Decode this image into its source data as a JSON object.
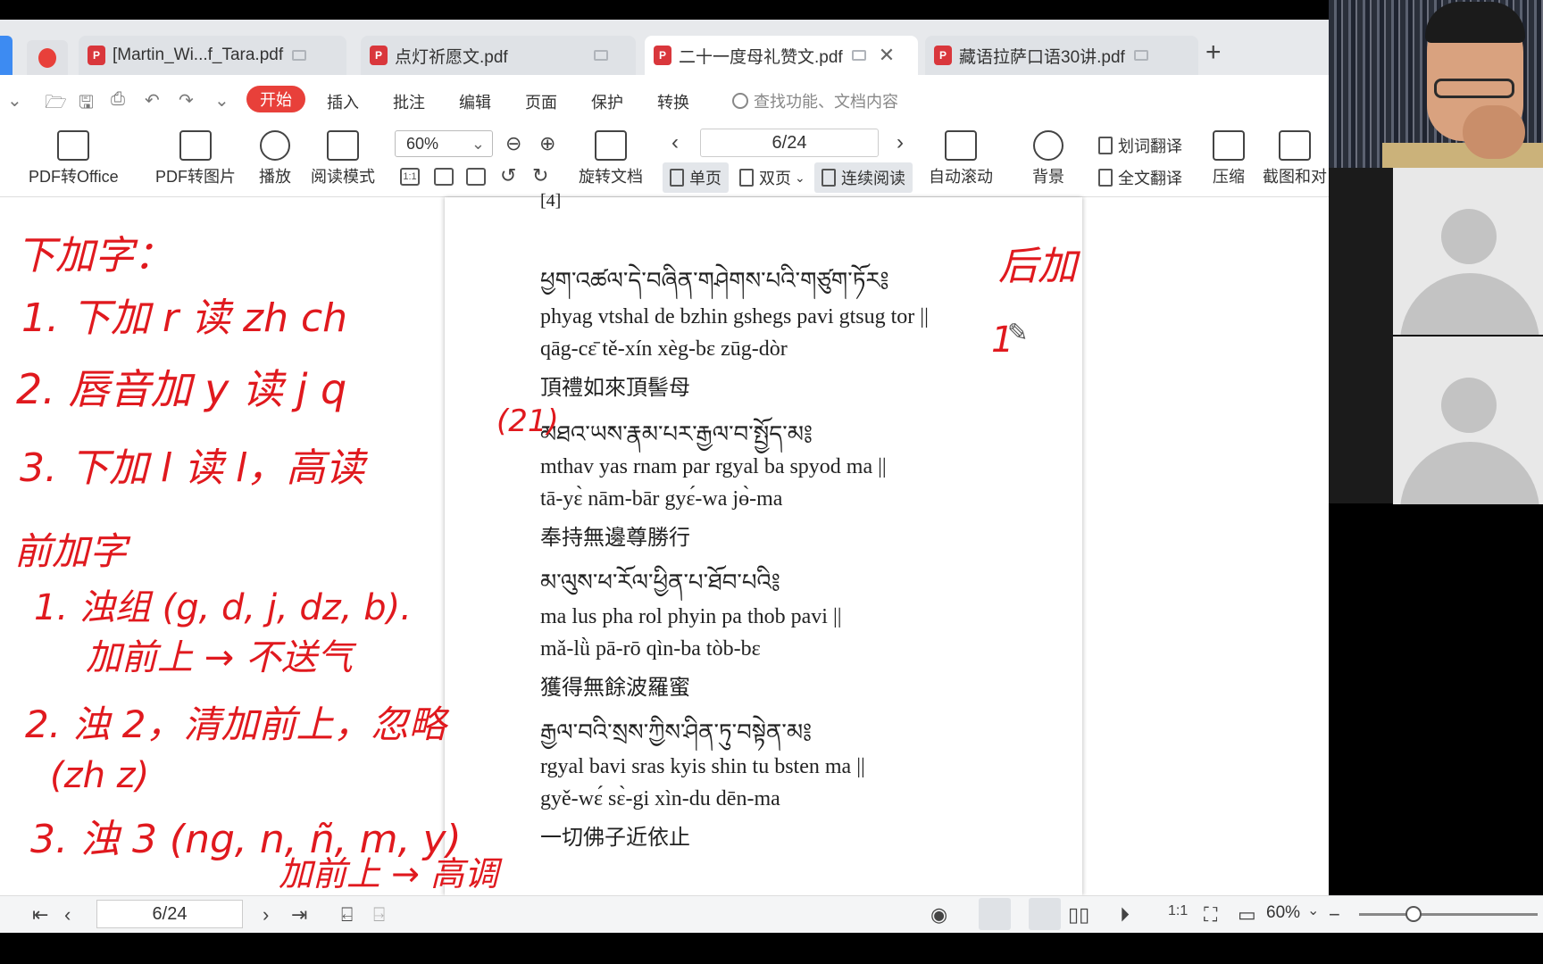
{
  "tabs": [
    {
      "label": "[Martin_Wi...f_Tara.pdf",
      "active": false
    },
    {
      "label": "点灯祈愿文.pdf",
      "active": false
    },
    {
      "label": "二十一度母礼赞文.pdf",
      "active": true
    },
    {
      "label": "藏语拉萨口语30讲.pdf",
      "active": false
    }
  ],
  "menu": {
    "start": "开始",
    "items": [
      "插入",
      "批注",
      "编辑",
      "页面",
      "保护",
      "转换"
    ],
    "search_placeholder": "查找功能、文档内容"
  },
  "toolbar": {
    "pdf_to_office": "PDF转Office",
    "pdf_to_image": "PDF转图片",
    "play": "播放",
    "read_mode": "阅读模式",
    "zoom": "60%",
    "rotate_doc": "旋转文档",
    "page_indicator": "6/24",
    "single_page": "单页",
    "double_page": "双页",
    "continuous": "连续阅读",
    "auto_scroll": "自动滚动",
    "background": "背景",
    "word_translate": "划词翻译",
    "full_translate": "全文翻译",
    "compress": "压缩",
    "screenshot": "截图和对"
  },
  "document": {
    "top_fragment": "[4]",
    "verses": [
      {
        "tibetan": "ཕྱག་འཚལ་དེ་བཞིན་གཤེགས་པའི་གཙུག་ཏོར༔",
        "wylie": "phyag vtshal de bzhin gshegs pavi gtsug tor ||",
        "phonetic": "qāg-cɛ̄ tě-xín xèg-bɛ zūg-dòr",
        "chinese": "頂禮如來頂髻母"
      },
      {
        "tibetan": "མཐའ་ཡས་རྣམ་པར་རྒྱལ་བ་སྤྱོད་མ༔",
        "wylie": "mthav yas rnam par rgyal ba spyod ma ||",
        "phonetic": "tā-yɛ̀ nām-bār gyɛ́-wa jɵ̀-ma",
        "chinese": "奉持無邊尊勝行"
      },
      {
        "tibetan": "མ་ལུས་ཕ་རོལ་ཕྱིན་པ་ཐོབ་པའི༔",
        "wylie": "ma lus pha rol phyin pa thob pavi ||",
        "phonetic": "mǎ-lǜ pā-rō qìn-ba tòb-bɛ",
        "chinese": "獲得無餘波羅蜜"
      },
      {
        "tibetan": "རྒྱལ་བའི་སྲས་ཀྱིས་ཤིན་ཏུ་བསྟེན་མ༔",
        "wylie": "rgyal bavi sras kyis shin tu bsten ma ||",
        "phonetic": "gyě-wɛ́ sɛ̀-gi xìn-du dēn-ma",
        "chinese": "一切佛子近依止"
      }
    ]
  },
  "annotations": {
    "left": [
      "下加字：",
      "1. 下加 r 读 zh ch",
      "2. 唇音加 y 读 j q",
      "3. 下加 l 读 l，高读",
      "前加字",
      "1. 浊组 (g, d, j, dz, b).",
      "加前上 → 不送气",
      "2. 浊 2，清加前上，忽略",
      "(zh z)",
      "3. 浊 3 (ng, n, ñ, m, y)",
      "加前上 → 高调"
    ],
    "side_number": "(21)",
    "right_title": "后加",
    "right_item": "1"
  },
  "statusbar": {
    "page_indicator": "6/24",
    "zoom": "60%"
  },
  "colors": {
    "accent_red": "#e8403a",
    "ink_red": "#e0191e",
    "tab_active_bg": "#ffffff"
  }
}
